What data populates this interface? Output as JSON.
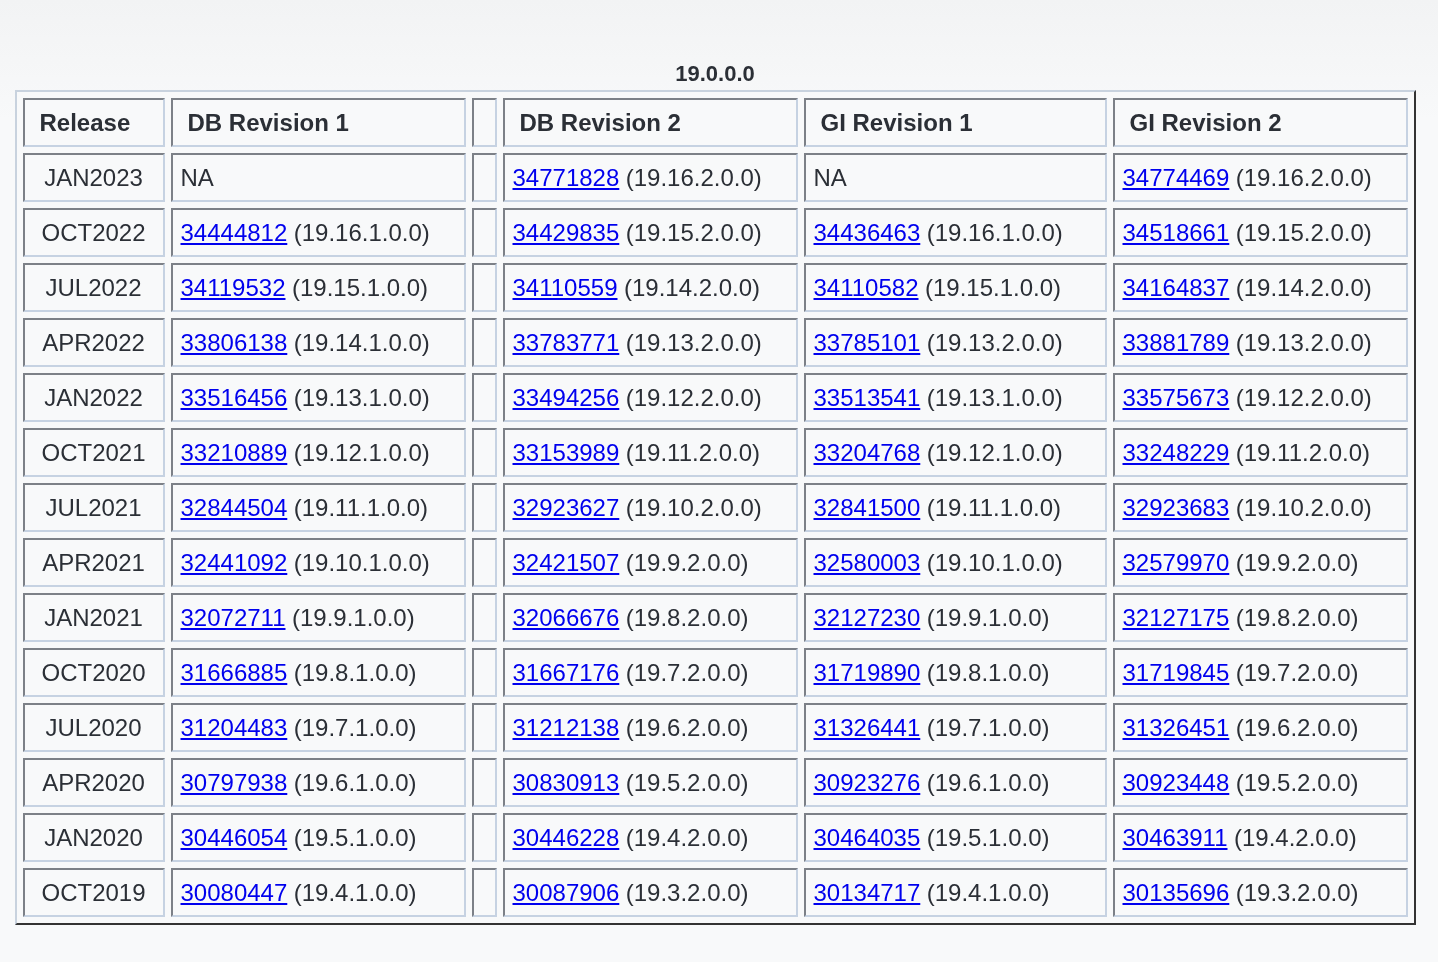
{
  "table": {
    "caption": "19.0.0.0",
    "columns": [
      {
        "kind": "text",
        "label": "Release"
      },
      {
        "kind": "text",
        "label": "DB Revision 1"
      },
      {
        "kind": "spacer"
      },
      {
        "kind": "text",
        "label": "DB Revision 2"
      },
      {
        "kind": "text",
        "label": "GI Revision 1"
      },
      {
        "kind": "text",
        "label": "GI Revision 2"
      }
    ],
    "rows": [
      {
        "cells": [
          {
            "kind": "release",
            "text": "JAN2023"
          },
          {
            "kind": "text",
            "text": "NA"
          },
          {
            "kind": "spacer"
          },
          {
            "kind": "patch",
            "patch": "34771828",
            "version": "(19.16.2.0.0)"
          },
          {
            "kind": "text",
            "text": "NA"
          },
          {
            "kind": "patch",
            "patch": "34774469",
            "version": "(19.16.2.0.0)"
          }
        ]
      },
      {
        "cells": [
          {
            "kind": "release",
            "text": "OCT2022"
          },
          {
            "kind": "patch",
            "patch": "34444812",
            "version": "(19.16.1.0.0)"
          },
          {
            "kind": "spacer"
          },
          {
            "kind": "patch",
            "patch": "34429835",
            "version": "(19.15.2.0.0)"
          },
          {
            "kind": "patch",
            "patch": "34436463",
            "version": "(19.16.1.0.0)"
          },
          {
            "kind": "patch",
            "patch": "34518661",
            "version": "(19.15.2.0.0)"
          }
        ]
      },
      {
        "cells": [
          {
            "kind": "release",
            "text": "JUL2022"
          },
          {
            "kind": "patch",
            "patch": "34119532",
            "version": "(19.15.1.0.0)"
          },
          {
            "kind": "spacer"
          },
          {
            "kind": "patch",
            "patch": "34110559",
            "version": "(19.14.2.0.0)"
          },
          {
            "kind": "patch",
            "patch": "34110582",
            "version": "(19.15.1.0.0)"
          },
          {
            "kind": "patch",
            "patch": "34164837",
            "version": "(19.14.2.0.0)"
          }
        ]
      },
      {
        "cells": [
          {
            "kind": "release",
            "text": "APR2022"
          },
          {
            "kind": "patch",
            "patch": "33806138",
            "version": "(19.14.1.0.0)"
          },
          {
            "kind": "spacer"
          },
          {
            "kind": "patch",
            "patch": "33783771",
            "version": "(19.13.2.0.0)"
          },
          {
            "kind": "patch",
            "patch": "33785101",
            "version": "(19.13.2.0.0)"
          },
          {
            "kind": "patch",
            "patch": "33881789",
            "version": "(19.13.2.0.0)"
          }
        ]
      },
      {
        "cells": [
          {
            "kind": "release",
            "text": "JAN2022"
          },
          {
            "kind": "patch",
            "patch": "33516456",
            "version": "(19.13.1.0.0)"
          },
          {
            "kind": "spacer"
          },
          {
            "kind": "patch",
            "patch": "33494256",
            "version": "(19.12.2.0.0)"
          },
          {
            "kind": "patch",
            "patch": "33513541",
            "version": "(19.13.1.0.0)"
          },
          {
            "kind": "patch",
            "patch": "33575673",
            "version": "(19.12.2.0.0)"
          }
        ]
      },
      {
        "cells": [
          {
            "kind": "release",
            "text": "OCT2021"
          },
          {
            "kind": "patch",
            "patch": "33210889",
            "version": "(19.12.1.0.0)"
          },
          {
            "kind": "spacer"
          },
          {
            "kind": "patch",
            "patch": "33153989",
            "version": "(19.11.2.0.0)"
          },
          {
            "kind": "patch",
            "patch": "33204768",
            "version": "(19.12.1.0.0)"
          },
          {
            "kind": "patch",
            "patch": "33248229",
            "version": "(19.11.2.0.0)"
          }
        ]
      },
      {
        "cells": [
          {
            "kind": "release",
            "text": "JUL2021"
          },
          {
            "kind": "patch",
            "patch": "32844504",
            "version": "(19.11.1.0.0)"
          },
          {
            "kind": "spacer"
          },
          {
            "kind": "patch",
            "patch": "32923627",
            "version": "(19.10.2.0.0)"
          },
          {
            "kind": "patch",
            "patch": "32841500",
            "version": "(19.11.1.0.0)"
          },
          {
            "kind": "patch",
            "patch": "32923683",
            "version": "(19.10.2.0.0)"
          }
        ]
      },
      {
        "cells": [
          {
            "kind": "release",
            "text": "APR2021"
          },
          {
            "kind": "patch",
            "patch": "32441092",
            "version": "(19.10.1.0.0)"
          },
          {
            "kind": "spacer"
          },
          {
            "kind": "patch",
            "patch": "32421507",
            "version": "(19.9.2.0.0)"
          },
          {
            "kind": "patch",
            "patch": "32580003",
            "version": "(19.10.1.0.0)"
          },
          {
            "kind": "patch",
            "patch": "32579970",
            "version": "(19.9.2.0.0)"
          }
        ]
      },
      {
        "cells": [
          {
            "kind": "release",
            "text": "JAN2021"
          },
          {
            "kind": "patch",
            "patch": "32072711",
            "version": "(19.9.1.0.0)"
          },
          {
            "kind": "spacer"
          },
          {
            "kind": "patch",
            "patch": "32066676",
            "version": "(19.8.2.0.0)"
          },
          {
            "kind": "patch",
            "patch": "32127230",
            "version": "(19.9.1.0.0)"
          },
          {
            "kind": "patch",
            "patch": "32127175",
            "version": "(19.8.2.0.0)"
          }
        ]
      },
      {
        "cells": [
          {
            "kind": "release",
            "text": "OCT2020"
          },
          {
            "kind": "patch",
            "patch": "31666885",
            "version": "(19.8.1.0.0)"
          },
          {
            "kind": "spacer"
          },
          {
            "kind": "patch",
            "patch": "31667176",
            "version": "(19.7.2.0.0)"
          },
          {
            "kind": "patch",
            "patch": "31719890",
            "version": "(19.8.1.0.0)"
          },
          {
            "kind": "patch",
            "patch": "31719845",
            "version": "(19.7.2.0.0)"
          }
        ]
      },
      {
        "cells": [
          {
            "kind": "release",
            "text": "JUL2020"
          },
          {
            "kind": "patch",
            "patch": "31204483",
            "version": "(19.7.1.0.0)"
          },
          {
            "kind": "spacer"
          },
          {
            "kind": "patch",
            "patch": "31212138",
            "version": "(19.6.2.0.0)"
          },
          {
            "kind": "patch",
            "patch": "31326441",
            "version": "(19.7.1.0.0)"
          },
          {
            "kind": "patch",
            "patch": "31326451",
            "version": "(19.6.2.0.0)"
          }
        ]
      },
      {
        "cells": [
          {
            "kind": "release",
            "text": "APR2020"
          },
          {
            "kind": "patch",
            "patch": "30797938",
            "version": "(19.6.1.0.0)"
          },
          {
            "kind": "spacer"
          },
          {
            "kind": "patch",
            "patch": "30830913",
            "version": "(19.5.2.0.0)"
          },
          {
            "kind": "patch",
            "patch": "30923276",
            "version": "(19.6.1.0.0)"
          },
          {
            "kind": "patch",
            "patch": "30923448",
            "version": "(19.5.2.0.0)"
          }
        ]
      },
      {
        "cells": [
          {
            "kind": "release",
            "text": "JAN2020"
          },
          {
            "kind": "patch",
            "patch": "30446054",
            "version": "(19.5.1.0.0)"
          },
          {
            "kind": "spacer"
          },
          {
            "kind": "patch",
            "patch": "30446228",
            "version": "(19.4.2.0.0)"
          },
          {
            "kind": "patch",
            "patch": "30464035",
            "version": "(19.5.1.0.0)"
          },
          {
            "kind": "patch",
            "patch": "30463911",
            "version": "(19.4.2.0.0)"
          }
        ]
      },
      {
        "cells": [
          {
            "kind": "release",
            "text": "OCT2019"
          },
          {
            "kind": "patch",
            "patch": "30080447",
            "version": "(19.4.1.0.0)"
          },
          {
            "kind": "spacer"
          },
          {
            "kind": "patch",
            "patch": "30087906",
            "version": "(19.3.2.0.0)"
          },
          {
            "kind": "patch",
            "patch": "30134717",
            "version": "(19.4.1.0.0)"
          },
          {
            "kind": "patch",
            "patch": "30135696",
            "version": "(19.3.2.0.0)"
          }
        ]
      }
    ]
  }
}
